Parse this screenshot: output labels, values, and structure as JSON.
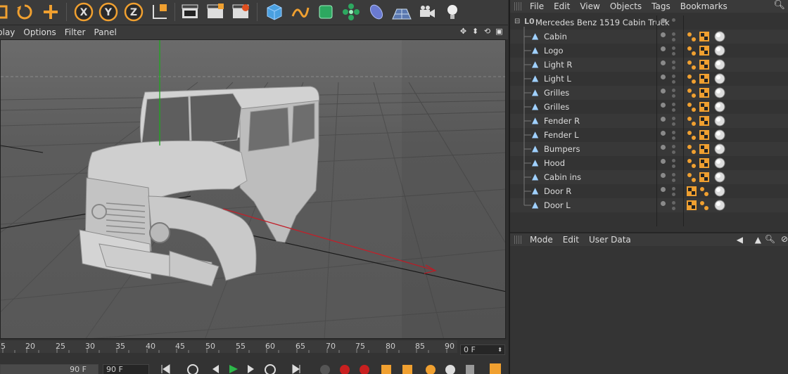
{
  "viewport_menu": {
    "items": [
      "play",
      "Options",
      "Filter",
      "Panel"
    ]
  },
  "object_manager": {
    "menu": [
      "File",
      "Edit",
      "View",
      "Objects",
      "Tags",
      "Bookmarks"
    ],
    "root": "Mercedes Benz 1519 Cabin Truck",
    "objects": [
      "Cabin",
      "Logo",
      "Light R",
      "Light L",
      "Grilles",
      "Grilles",
      "Fender R",
      "Fender L",
      "Bumpers",
      "Hood",
      "Cabin ins",
      "Door R",
      "Door L"
    ]
  },
  "attribute_manager": {
    "menu": [
      "Mode",
      "Edit",
      "User Data"
    ]
  },
  "timeline": {
    "ticks": [
      "5",
      "20",
      "25",
      "30",
      "35",
      "40",
      "45",
      "50",
      "55",
      "60",
      "65",
      "70",
      "75",
      "80",
      "85",
      "90"
    ],
    "current_frame": "0 F",
    "end_frame_a": "90 F",
    "end_frame_b": "90 F"
  },
  "colors": {
    "accent_orange": "#f0a030",
    "axis_green": "#1fa81f",
    "axis_red": "#c0202a"
  }
}
